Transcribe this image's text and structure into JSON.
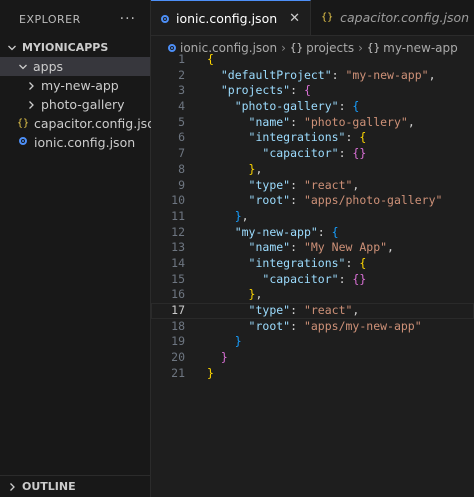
{
  "explorer": {
    "title": "EXPLORER",
    "more": "···",
    "root": "MYIONICAPPS",
    "items": [
      {
        "label": "apps",
        "indent": 1,
        "state": "open"
      },
      {
        "label": "my-new-app",
        "indent": 2,
        "state": "closed"
      },
      {
        "label": "photo-gallery",
        "indent": 2,
        "state": "closed"
      },
      {
        "label": "capacitor.config.json",
        "indent": 1,
        "icon": "json-braces-icon"
      },
      {
        "label": "ionic.config.json",
        "indent": 1,
        "icon": "ionic-icon"
      }
    ],
    "outline": "OUTLINE"
  },
  "tabs": [
    {
      "label": "ionic.config.json",
      "active": true,
      "icon": "ionic-icon",
      "close": "✕"
    },
    {
      "label": "capacitor.config.json",
      "active": false,
      "icon": "json-braces-icon"
    }
  ],
  "breadcrumb": [
    "ionic.config.json",
    "projects",
    "my-new-app"
  ],
  "current_line": 17,
  "code_lines": [
    [
      [
        "b1",
        "{"
      ]
    ],
    [
      [
        "p",
        "  "
      ],
      [
        "k",
        "\"defaultProject\""
      ],
      [
        "p",
        ": "
      ],
      [
        "s",
        "\"my-new-app\""
      ],
      [
        "p",
        ","
      ]
    ],
    [
      [
        "p",
        "  "
      ],
      [
        "k",
        "\"projects\""
      ],
      [
        "p",
        ": "
      ],
      [
        "b2",
        "{"
      ]
    ],
    [
      [
        "p",
        "    "
      ],
      [
        "k",
        "\"photo-gallery\""
      ],
      [
        "p",
        ": "
      ],
      [
        "b3",
        "{"
      ]
    ],
    [
      [
        "p",
        "      "
      ],
      [
        "k",
        "\"name\""
      ],
      [
        "p",
        ": "
      ],
      [
        "s",
        "\"photo-gallery\""
      ],
      [
        "p",
        ","
      ]
    ],
    [
      [
        "p",
        "      "
      ],
      [
        "k",
        "\"integrations\""
      ],
      [
        "p",
        ": "
      ],
      [
        "b1",
        "{"
      ]
    ],
    [
      [
        "p",
        "        "
      ],
      [
        "k",
        "\"capacitor\""
      ],
      [
        "p",
        ": "
      ],
      [
        "b2",
        "{}"
      ]
    ],
    [
      [
        "p",
        "      "
      ],
      [
        "b1",
        "}"
      ],
      [
        "p",
        ","
      ]
    ],
    [
      [
        "p",
        "      "
      ],
      [
        "k",
        "\"type\""
      ],
      [
        "p",
        ": "
      ],
      [
        "s",
        "\"react\""
      ],
      [
        "p",
        ","
      ]
    ],
    [
      [
        "p",
        "      "
      ],
      [
        "k",
        "\"root\""
      ],
      [
        "p",
        ": "
      ],
      [
        "s",
        "\"apps/photo-gallery\""
      ]
    ],
    [
      [
        "p",
        "    "
      ],
      [
        "b3",
        "}"
      ],
      [
        "p",
        ","
      ]
    ],
    [
      [
        "p",
        "    "
      ],
      [
        "k",
        "\"my-new-app\""
      ],
      [
        "p",
        ": "
      ],
      [
        "b3",
        "{"
      ]
    ],
    [
      [
        "p",
        "      "
      ],
      [
        "k",
        "\"name\""
      ],
      [
        "p",
        ": "
      ],
      [
        "s",
        "\"My New App\""
      ],
      [
        "p",
        ","
      ]
    ],
    [
      [
        "p",
        "      "
      ],
      [
        "k",
        "\"integrations\""
      ],
      [
        "p",
        ": "
      ],
      [
        "b1",
        "{"
      ]
    ],
    [
      [
        "p",
        "        "
      ],
      [
        "k",
        "\"capacitor\""
      ],
      [
        "p",
        ": "
      ],
      [
        "b2",
        "{}"
      ]
    ],
    [
      [
        "p",
        "      "
      ],
      [
        "b1",
        "}"
      ],
      [
        "p",
        ","
      ]
    ],
    [
      [
        "p",
        "      "
      ],
      [
        "k",
        "\"type\""
      ],
      [
        "p",
        ": "
      ],
      [
        "s",
        "\"react\""
      ],
      [
        "p",
        ","
      ]
    ],
    [
      [
        "p",
        "      "
      ],
      [
        "k",
        "\"root\""
      ],
      [
        "p",
        ": "
      ],
      [
        "s",
        "\"apps/my-new-app\""
      ]
    ],
    [
      [
        "p",
        "    "
      ],
      [
        "b3",
        "}"
      ]
    ],
    [
      [
        "p",
        "  "
      ],
      [
        "b2",
        "}"
      ]
    ],
    [
      [
        "b1",
        "}"
      ]
    ]
  ],
  "colors": {
    "accent": "#4d8ff7",
    "key": "#9cdcfe",
    "string": "#ce9178"
  }
}
